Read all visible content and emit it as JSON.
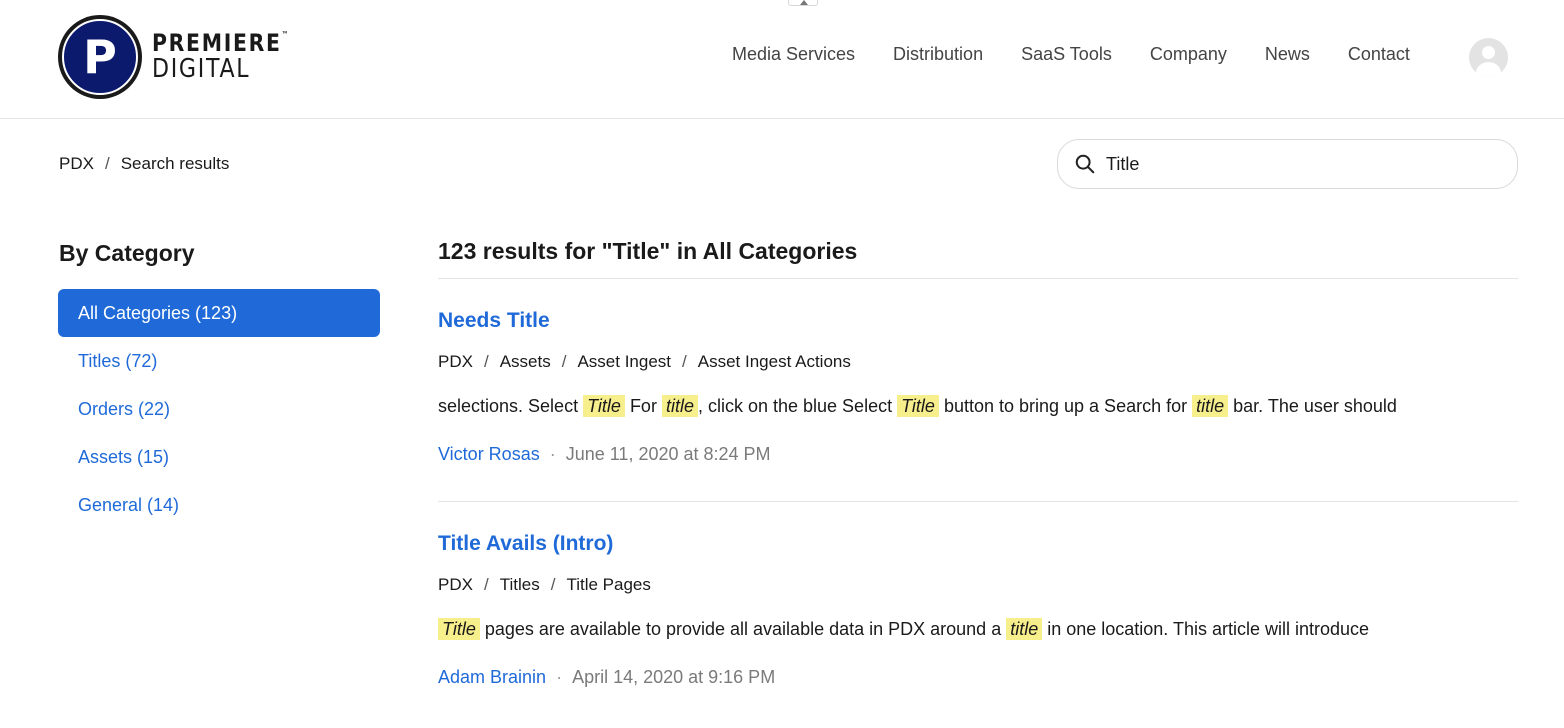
{
  "brand": {
    "mark": "P",
    "line1": "PREMIERE",
    "line2": "DIGITAL",
    "tm": "™"
  },
  "nav": [
    {
      "label": "Media Services"
    },
    {
      "label": "Distribution"
    },
    {
      "label": "SaaS Tools"
    },
    {
      "label": "Company"
    },
    {
      "label": "News"
    },
    {
      "label": "Contact"
    }
  ],
  "breadcrumb": {
    "root": "PDX",
    "separator": "/",
    "current": "Search results"
  },
  "search": {
    "value": "Title"
  },
  "sidebar": {
    "title": "By Category",
    "items": [
      {
        "label": "All Categories (123)",
        "active": true
      },
      {
        "label": "Titles (72)",
        "active": false
      },
      {
        "label": "Orders (22)",
        "active": false
      },
      {
        "label": "Assets (15)",
        "active": false
      },
      {
        "label": "General (14)",
        "active": false
      }
    ]
  },
  "results": {
    "heading": "123 results for \"Title\" in All Categories",
    "items": [
      {
        "title": "Needs Title",
        "crumbs": [
          "PDX",
          "Assets",
          "Asset Ingest",
          "Asset Ingest Actions"
        ],
        "snippet": [
          {
            "text": "selections. Select ",
            "hl": false
          },
          {
            "text": "Title",
            "hl": true
          },
          {
            "text": " For ",
            "hl": false
          },
          {
            "text": "title",
            "hl": true
          },
          {
            "text": ", click on the blue Select ",
            "hl": false
          },
          {
            "text": "Title",
            "hl": true
          },
          {
            "text": " button to bring up a Search for ",
            "hl": false
          },
          {
            "text": "title",
            "hl": true
          },
          {
            "text": " bar. The user should",
            "hl": false
          }
        ],
        "author": "Victor Rosas",
        "date": "June 11, 2020 at 8:24 PM"
      },
      {
        "title": "Title Avails (Intro)",
        "crumbs": [
          "PDX",
          "Titles",
          "Title Pages"
        ],
        "snippet": [
          {
            "text": "Title",
            "hl": true
          },
          {
            "text": " pages are available to provide all available data in PDX around a ",
            "hl": false
          },
          {
            "text": "title",
            "hl": true
          },
          {
            "text": " in one location. This article will introduce",
            "hl": false
          }
        ],
        "author": "Adam Brainin",
        "date": "April 14, 2020 at 9:16 PM"
      }
    ]
  },
  "colors": {
    "accent": "#1f6ad8",
    "highlight": "#f7ee8c",
    "brand_navy": "#0c1a6e"
  }
}
